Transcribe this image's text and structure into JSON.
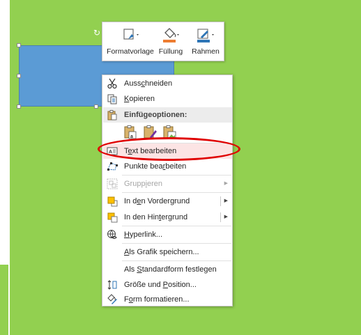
{
  "mini_toolbar": {
    "style_label": "Formatvorlage",
    "fill_label": "Füllung",
    "outline_label": "Rahmen"
  },
  "context_menu": {
    "cut": [
      "Auss",
      "c",
      "hneiden"
    ],
    "copy": [
      "",
      "K",
      "opieren"
    ],
    "paste_header": "Einfügeoptionen:",
    "edit_text": [
      "T",
      "e",
      "xt bearbeiten"
    ],
    "edit_points": [
      "Punkte bea",
      "r",
      "beiten"
    ],
    "group": [
      "Grupp",
      "i",
      "eren"
    ],
    "bring_front": [
      "In d",
      "e",
      "n Vordergrund"
    ],
    "send_back": [
      "In den Hin",
      "t",
      "ergrund"
    ],
    "hyperlink": [
      "",
      "H",
      "yperlink..."
    ],
    "save_as_picture": [
      "",
      "A",
      "ls Grafik speichern..."
    ],
    "set_default": [
      "Als ",
      "S",
      "tandardform festlegen"
    ],
    "size_position": [
      "Größe und ",
      "P",
      "osition..."
    ],
    "format_shape": [
      "F",
      "o",
      "rm formatieren..."
    ]
  },
  "colors": {
    "canvas": "#92d050",
    "shape_fill": "#5b9bd5",
    "fill_accent": "#ed7d31",
    "outline_accent": "#2e75b6",
    "highlight_ring": "#e00000"
  }
}
